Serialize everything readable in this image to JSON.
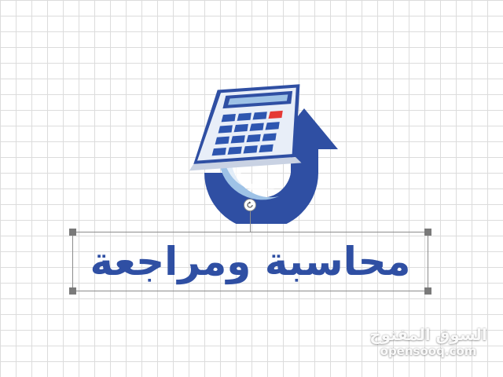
{
  "colors": {
    "brand_blue": "#2f4fa3",
    "light_blue": "#9ec2e6",
    "calc_face": "#e8eef8",
    "calc_key": "#2e56b0",
    "calc_key_red": "#e53935",
    "grid_line": "#dcdcdc",
    "selection_border": "#8c8c8c",
    "handle": "#7a7a7a"
  },
  "logo": {
    "icon": "calculator-with-upward-arrow-icon"
  },
  "text_element": {
    "value": "محاسبة ومراجعة",
    "color": "#2f4fa3"
  },
  "selection": {
    "rotate_icon": "rotate-icon"
  },
  "watermark": {
    "arabic": "السوق المفتوح",
    "latin": "opensooq.com"
  }
}
